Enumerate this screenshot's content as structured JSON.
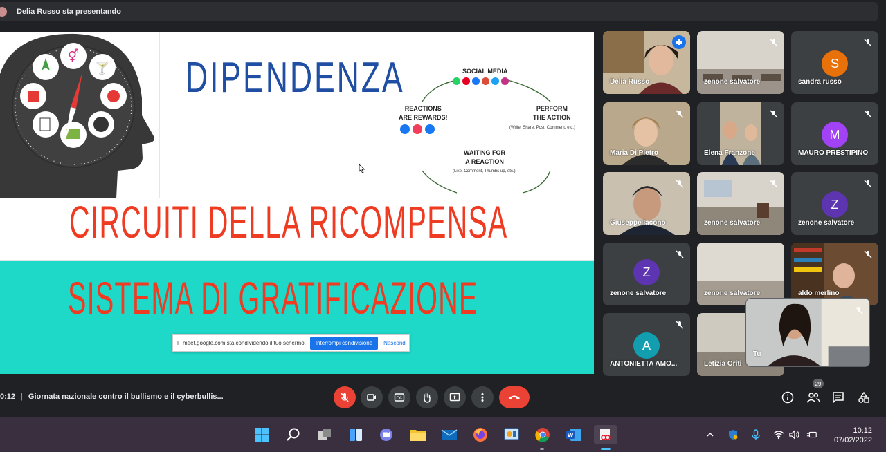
{
  "topbar": {
    "presenting_text": "Delia Russo sta presentando"
  },
  "slide": {
    "title_main": "DIPENDENZA",
    "title_red_1": "CIRCUITI DELLA RICOMPENSA",
    "title_red_2": "SISTEMA DI GRATIFICAZIONE",
    "cycle": {
      "top_label": "SOCIAL MEDIA",
      "right_label_1": "PERFORM",
      "right_label_2": "THE ACTION",
      "right_sub": "(Write, Share, Post, Comment, etc.)",
      "bottom_label_1": "WAITING FOR",
      "bottom_label_2": "A REACTION",
      "bottom_sub": "(Like, Comment, Thumbs up, etc.)",
      "left_label_1": "REACTIONS",
      "left_label_2": "ARE REWARDS!"
    },
    "share_bar": {
      "text": "meet.google.com sta condividendo il tuo schermo.",
      "stop_label": "Interrompi condivisione",
      "hide_label": "Nascondi"
    }
  },
  "participants": [
    {
      "name": "Delia Russo"
    },
    {
      "name": "zenone salvatore"
    },
    {
      "name": "sandra russo",
      "initial": "S",
      "color": "#e8710a"
    },
    {
      "name": "Maria Di Pietro"
    },
    {
      "name": "Elena Franzone"
    },
    {
      "name": "MAURO PRESTIPINO",
      "initial": "M",
      "color": "#a142f4"
    },
    {
      "name": "Giuseppe Iacono"
    },
    {
      "name": "zenone salvatore"
    },
    {
      "name": "zenone salvatore",
      "initial": "Z",
      "color": "#5e35b1"
    },
    {
      "name": "zenone salvatore",
      "initial": "Z",
      "color": "#5e35b1"
    },
    {
      "name": "zenone salvatore"
    },
    {
      "name": "aldo merlino"
    },
    {
      "name": "ANTONIETTA AMO...",
      "initial": "A",
      "color": "#129eaf"
    },
    {
      "name": "Letizia Oriti"
    },
    {
      "name": "Tu"
    }
  ],
  "controls": {
    "time_partial": "0:12",
    "meeting_title": "Giornata nazionale contro il bullismo e il cyberbullis...",
    "participants_count": "29"
  },
  "taskbar": {
    "time": "10:12",
    "date": "07/02/2022"
  },
  "colors": {
    "accent": "#1a73e8",
    "danger": "#ea4335",
    "teal": "#1ed8c8",
    "slide_red": "#ef3b22",
    "slide_blue": "#1f4ea3"
  }
}
